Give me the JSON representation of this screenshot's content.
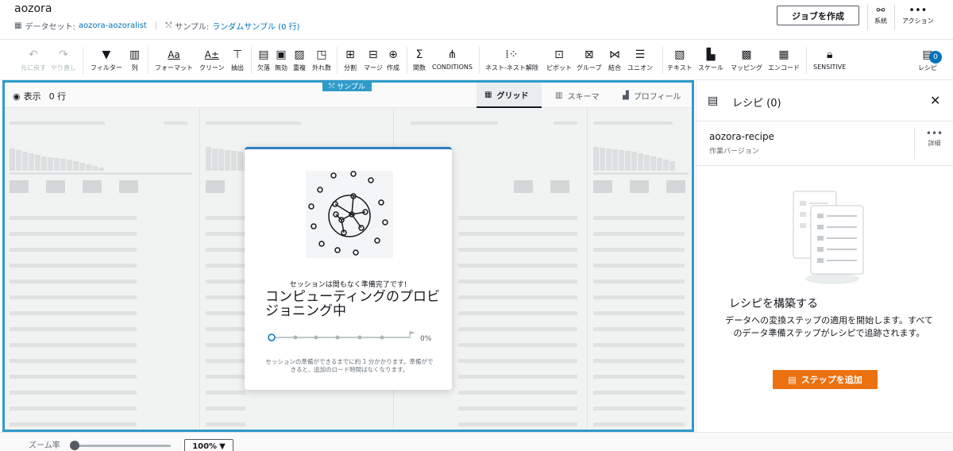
{
  "header": {
    "title": "aozora",
    "dataset_label": "データセット:",
    "dataset_value": "aozora-aozoralist",
    "sample_label": "サンプル:",
    "sample_value": "ランダムサンプル (0 行)",
    "create_job_label": "ジョブを作成",
    "lineage_label": "系統",
    "actions_label": "アクション"
  },
  "toolbar": {
    "undo": "元に戻す",
    "redo": "やり直し",
    "filter": "フィルター",
    "column": "列",
    "format": "フォーマット",
    "clean": "クリーン",
    "extract": "抽出",
    "missing": "欠落",
    "invalid": "無効",
    "duplicate": "重複",
    "outlier": "外れ数",
    "split": "分割",
    "merge": "マージ",
    "create": "作成",
    "function": "関数",
    "conditions": "CONDITIONS",
    "nest": "ネスト-ネスト解除",
    "pivot": "ピボット",
    "group": "グループ",
    "join": "結合",
    "union": "ユニオン",
    "text": "テキスト",
    "scale": "スケール",
    "mapping": "マッピング",
    "encode": "エンコード",
    "sensitive": "SENSITIVE",
    "recipe": "レシピ",
    "recipe_count": "0"
  },
  "grid": {
    "sample_tag": "サンプル",
    "show_label": "表示",
    "show_count": "0 行",
    "tab_grid": "グリッド",
    "tab_schema": "スキーマ",
    "tab_profile": "プロフィール"
  },
  "modal": {
    "status": "セッションは間もなく準備完了です!",
    "title": "コンピューティングのプロビジョニング中",
    "progress_pct": "0%",
    "progress_value": 0,
    "note": "セッションの準備ができるまでに約 1 分かかります。準備ができると、追加のロード時間はなくなります。"
  },
  "recipe_panel": {
    "title": "レシピ (0)",
    "recipe_name": "aozora-recipe",
    "recipe_version": "作業バージョン",
    "more_label": "詳細",
    "heading": "レシピを構築する",
    "description": "データへの変換ステップの適用を開始します。すべてのデータ準備ステップがレシピで追跡されます。",
    "add_step": "ステップを追加"
  },
  "bottom": {
    "zoom_label": "ズーム率",
    "zoom_value": "100%"
  },
  "colors": {
    "accent": "#2f9bc9",
    "link": "#0073bb",
    "primary_button": "#ec7211"
  }
}
